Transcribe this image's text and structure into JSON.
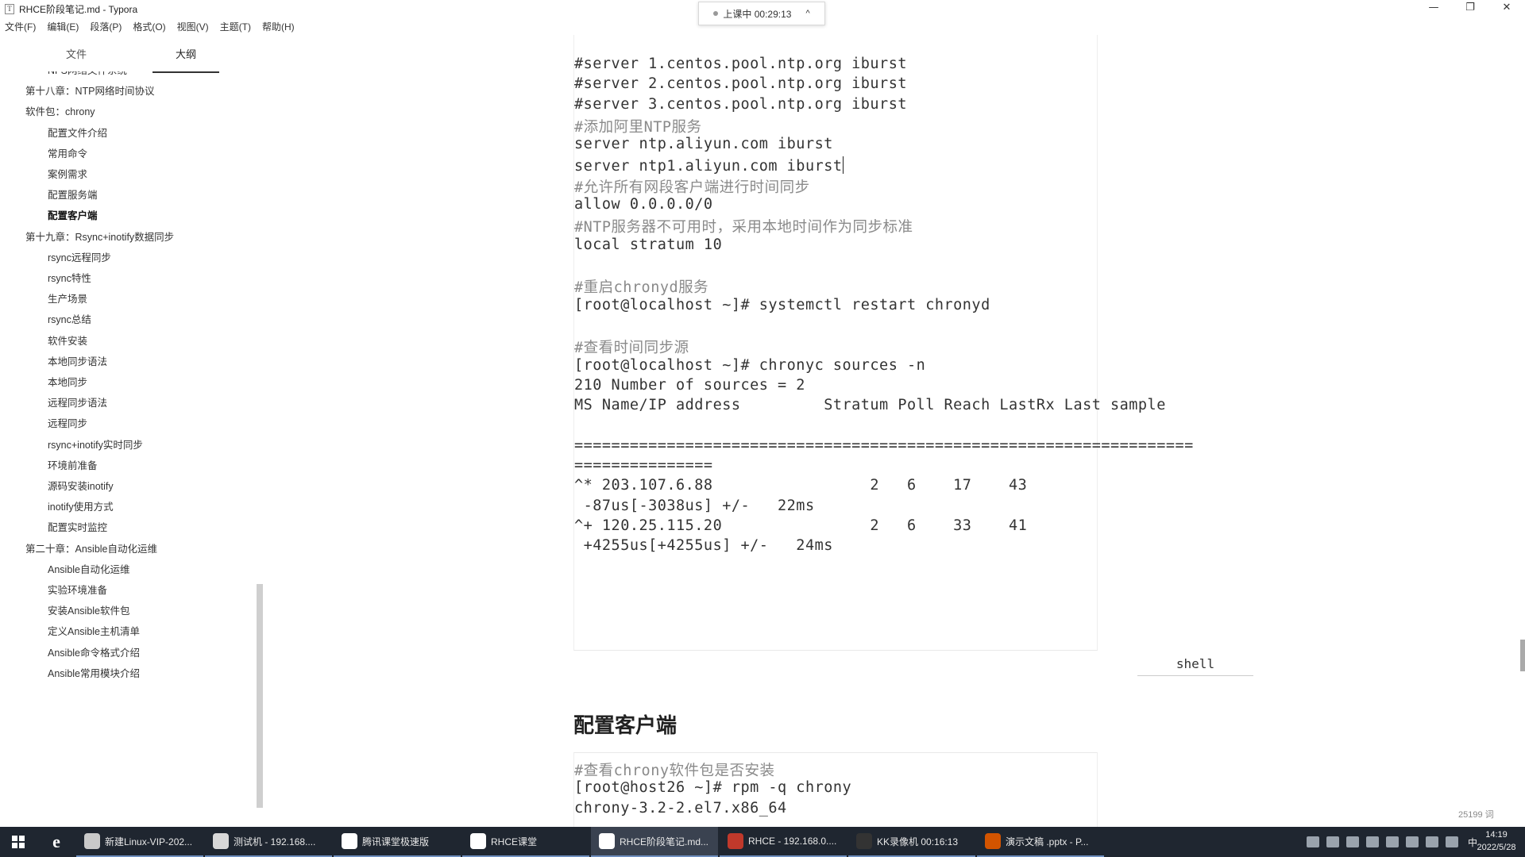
{
  "window": {
    "title": "RHCE阶段笔记.md - Typora",
    "icon_letter": "T",
    "controls": [
      "—",
      "❐",
      "✕"
    ]
  },
  "meeting_badge": {
    "text": "上课中 00:29:13",
    "chevron": "^"
  },
  "menu": [
    "文件(F)",
    "编辑(E)",
    "段落(P)",
    "格式(O)",
    "视图(V)",
    "主题(T)",
    "帮助(H)"
  ],
  "sidebar": {
    "tabs": {
      "file": "文件",
      "outline": "大纲",
      "active": "outline"
    },
    "items": [
      {
        "label": "NFS网络文件系统",
        "level": 2
      },
      {
        "label": "第十八章：NTP网络时间协议",
        "level": 1
      },
      {
        "label": "软件包：chrony",
        "level": 1
      },
      {
        "label": "配置文件介绍",
        "level": 2
      },
      {
        "label": "常用命令",
        "level": 2
      },
      {
        "label": "案例需求",
        "level": 2
      },
      {
        "label": "配置服务端",
        "level": 2
      },
      {
        "label": "配置客户端",
        "level": 2,
        "active": true
      },
      {
        "label": "第十九章：Rsync+inotify数据同步",
        "level": 1
      },
      {
        "label": "rsync远程同步",
        "level": 2
      },
      {
        "label": "rsync特性",
        "level": 2
      },
      {
        "label": "生产场景",
        "level": 2
      },
      {
        "label": "rsync总结",
        "level": 2
      },
      {
        "label": "软件安装",
        "level": 2
      },
      {
        "label": "本地同步语法",
        "level": 2
      },
      {
        "label": "本地同步",
        "level": 2
      },
      {
        "label": "远程同步语法",
        "level": 2
      },
      {
        "label": "远程同步",
        "level": 2
      },
      {
        "label": "rsync+inotify实时同步",
        "level": 2
      },
      {
        "label": "环境前准备",
        "level": 2
      },
      {
        "label": "源码安装inotify",
        "level": 2
      },
      {
        "label": "inotify使用方式",
        "level": 2
      },
      {
        "label": "配置实时监控",
        "level": 2
      },
      {
        "label": "第二十章：Ansible自动化运维",
        "level": 1
      },
      {
        "label": "Ansible自动化运维",
        "level": 2
      },
      {
        "label": "实验环境准备",
        "level": 2
      },
      {
        "label": "安装Ansible软件包",
        "level": 2
      },
      {
        "label": "定义Ansible主机清单",
        "level": 2
      },
      {
        "label": "Ansible命令格式介绍",
        "level": 2
      },
      {
        "label": "Ansible常用模块介绍",
        "level": 2
      }
    ],
    "footer": {
      "left_icon": "‹",
      "source_icon": "</>"
    }
  },
  "editor": {
    "code_block_1": [
      {
        "text": "#server 1.centos.pool.ntp.org iburst",
        "comment": false
      },
      {
        "text": "#server 2.centos.pool.ntp.org iburst",
        "comment": false
      },
      {
        "text": "#server 3.centos.pool.ntp.org iburst",
        "comment": false
      },
      {
        "text": "#添加阿里NTP服务",
        "comment": true
      },
      {
        "text": "server ntp.aliyun.com iburst",
        "comment": false
      },
      {
        "text": "server ntp1.aliyun.com iburst",
        "comment": false,
        "caret": true
      },
      {
        "text": "#允许所有网段客户端进行时间同步",
        "comment": true
      },
      {
        "text": "allow 0.0.0.0/0",
        "comment": false
      },
      {
        "text": "#NTP服务器不可用时，采用本地时间作为同步标准",
        "comment": true
      },
      {
        "text": "local stratum 10",
        "comment": false
      },
      {
        "text": "",
        "comment": false
      },
      {
        "text": "#重启chronyd服务",
        "comment": true
      },
      {
        "text": "[root@localhost ~]# systemctl restart chronyd",
        "comment": false
      },
      {
        "text": "",
        "comment": false
      },
      {
        "text": "#查看时间同步源",
        "comment": true
      },
      {
        "text": "[root@localhost ~]# chronyc sources -n",
        "comment": false
      },
      {
        "text": "210 Number of sources = 2",
        "comment": false
      },
      {
        "text": "MS Name/IP address         Stratum Poll Reach LastRx Last sample",
        "comment": false
      },
      {
        "text": "",
        "comment": false
      },
      {
        "text": "===================================================================",
        "comment": false
      },
      {
        "text": "===============",
        "comment": false
      },
      {
        "text": "^* 203.107.6.88                 2   6    17    43",
        "comment": false
      },
      {
        "text": " -87us[-3038us] +/-   22ms",
        "comment": false
      },
      {
        "text": "^+ 120.25.115.20                2   6    33    41",
        "comment": false
      },
      {
        "text": " +4255us[+4255us] +/-   24ms",
        "comment": false
      }
    ],
    "lang_label": "shell",
    "heading": "配置客户端",
    "code_block_2": [
      {
        "text": "#查看chrony软件包是否安装",
        "comment": true
      },
      {
        "text": "[root@host26 ~]# rpm -q chrony",
        "comment": false
      },
      {
        "text": "chrony-3.2-2.el7.x86_64",
        "comment": false
      }
    ],
    "word_count": "25199 词"
  },
  "taskbar": {
    "items": [
      {
        "label": "新建Linux-VIP-202...",
        "color": "#c9c9c9",
        "active": false
      },
      {
        "label": "测试机 - 192.168....",
        "color": "#d8d8d8",
        "active": false
      },
      {
        "label": "腾讯课堂极速版",
        "color": "#ffffff",
        "active": false
      },
      {
        "label": "RHCE课堂",
        "color": "#ffffff",
        "active": false
      },
      {
        "label": "RHCE阶段笔记.md...",
        "color": "#ffffff",
        "active": true
      },
      {
        "label": "RHCE - 192.168.0....",
        "color": "#c0392b",
        "active": false
      },
      {
        "label": "KK录像机 00:16:13",
        "color": "#333333",
        "active": false
      },
      {
        "label": "演示文稿 .pptx - P...",
        "color": "#d35400",
        "active": false
      }
    ],
    "ime": "中",
    "time": "14:19",
    "date": "2022/5/28"
  }
}
